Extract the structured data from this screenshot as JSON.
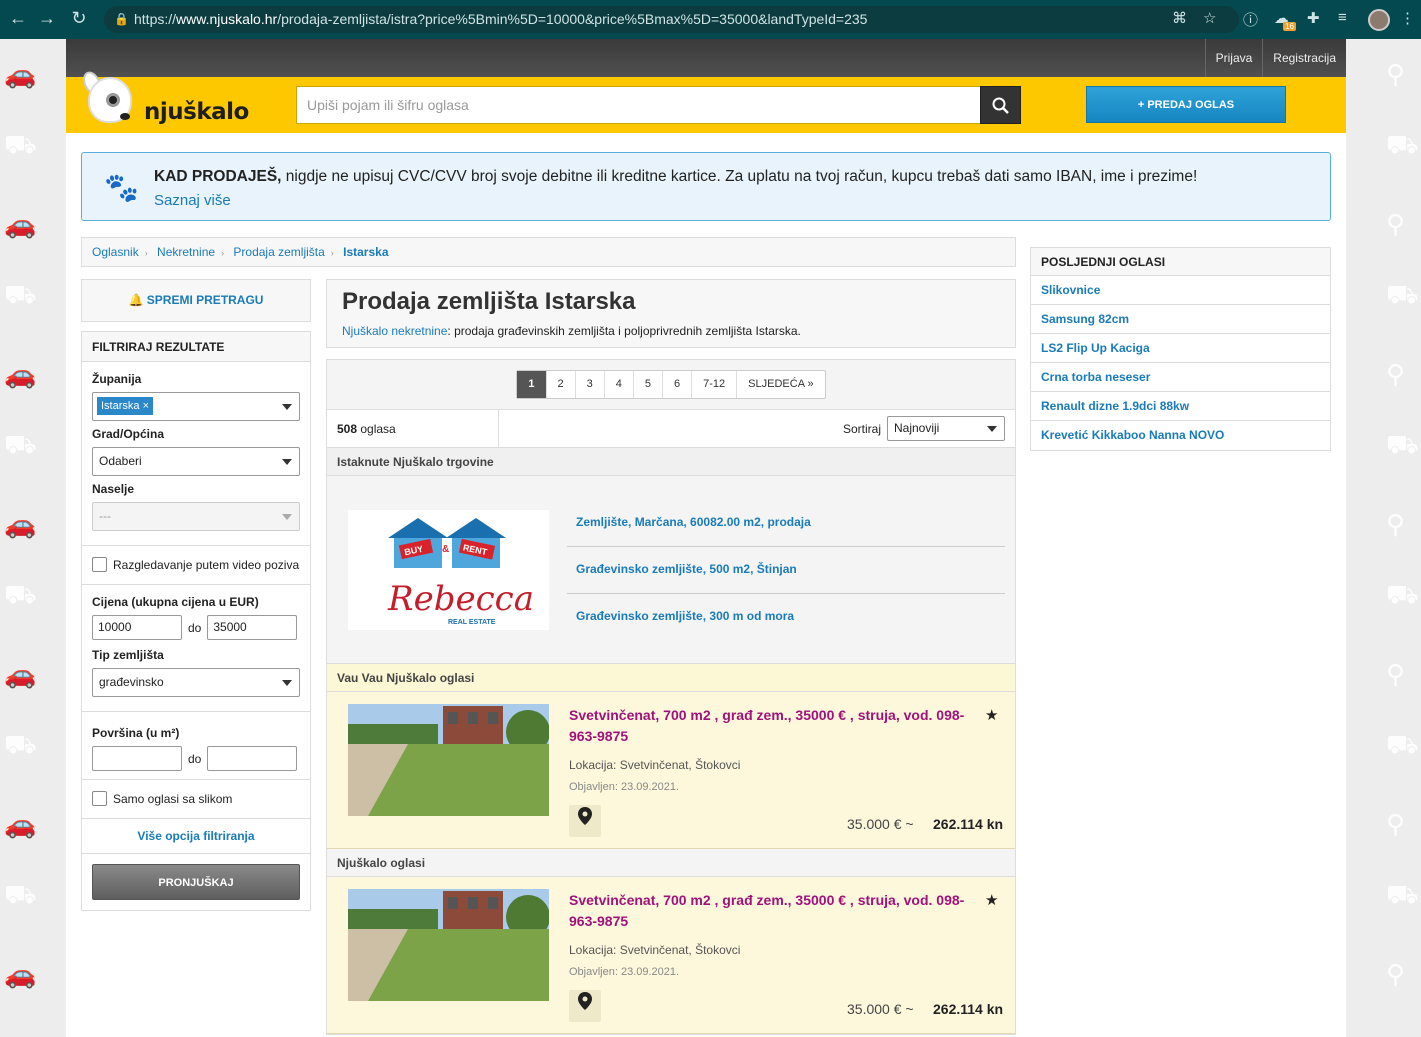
{
  "browser": {
    "url_prefix": "https://",
    "url_host": "www.njuskalo.hr",
    "url_path": "/prodaja-zemljista/istra?price%5Bmin%5D=10000&price%5Bmax%5D=35000&landTypeId=235",
    "ext_badge": "16"
  },
  "topbar": {
    "login": "Prijava",
    "register": "Registracija"
  },
  "header": {
    "logo": "njuškalo",
    "search_placeholder": "Upiši pojam ili šifru oglasa",
    "sell_button": "+ PREDAJ OGLAS"
  },
  "notice": {
    "bold": "KAD PRODAJEŠ,",
    "text": " nigdje ne upisuj CVC/CVV broj svoje debitne ili kreditne kartice. Za uplatu na tvoj račun, kupcu trebaš dati samo IBAN, ime i prezime!",
    "link": "Saznaj više"
  },
  "breadcrumb": [
    "Oglasnik",
    "Nekretnine",
    "Prodaja zemljišta",
    "Istarska"
  ],
  "filter": {
    "save_search": "SPREMI PRETRAGU",
    "header": "FILTRIRAJ REZULTATE",
    "county_label": "Županija",
    "county_tag": "Istarska",
    "city_label": "Grad/Općina",
    "city_value": "Odaberi",
    "settlement_label": "Naselje",
    "settlement_value": "---",
    "video_label": "Razgledavanje putem video poziva",
    "price_label": "Cijena (ukupna cijena u EUR)",
    "price_min": "10000",
    "price_to": "do",
    "price_max": "35000",
    "land_type_label": "Tip zemljišta",
    "land_type_value": "građevinsko",
    "area_label": "Površina (u m²)",
    "area_to": "do",
    "with_image_label": "Samo oglasi sa slikom",
    "more_options": "Više opcija filtriranja",
    "submit": "PRONJUŠKAJ"
  },
  "main": {
    "title": "Prodaja zemljišta Istarska",
    "subtitle_link": "Njuškalo nekretnine",
    "subtitle_text": ": prodaja građevinskih zemljišta i poljoprivrednih zemljišta Istarska.",
    "pages": [
      "1",
      "2",
      "3",
      "4",
      "5",
      "6",
      "7-12",
      "SLJEDEĆA »"
    ],
    "count_num": "508",
    "count_text": " oglasa",
    "sort_label": "Sortiraj",
    "sort_value": "Najnoviji",
    "store_section": "Istaknute Njuškalo trgovine",
    "store_name": "Rebecca",
    "store_sub": "REAL ESTATE",
    "store_buy": "BUY",
    "store_rent": "RENT",
    "store_links": [
      "Zemljište, Marčana, 60082.00 m2, prodaja",
      "Građevinsko zemljište, 500 m2, Štinjan",
      "Građevinsko zemljište, 300 m od mora"
    ],
    "vau_section": "Vau Vau Njuškalo oglasi",
    "plain_section": "Njuškalo oglasi",
    "ads": [
      {
        "title": "Svetvinčenat, 700 m2 , građ zem., 35000 € , struja, vod. 098-963-9875",
        "location": "Lokacija: Svetvinčenat, Štokovci",
        "date": "Objavljen: 23.09.2021.",
        "price_eur": "35.000 € ~",
        "price_kn": "262.114 kn"
      },
      {
        "title": "Svetvinčenat, 700 m2 , građ zem., 35000 € , struja, vod. 098-963-9875",
        "location": "Lokacija: Svetvinčenat, Štokovci",
        "date": "Objavljen: 23.09.2021.",
        "price_eur": "35.000 € ~",
        "price_kn": "262.114 kn"
      }
    ]
  },
  "recent": {
    "header": "POSLJEDNJI OGLASI",
    "items": [
      "Slikovnice",
      "Samsung 82cm",
      "LS2 Flip Up Kaciga",
      "Crna torba neseser",
      "Renault dizne 1.9dci 88kw",
      "Krevetić Kikkaboo Nanna NOVO"
    ]
  }
}
